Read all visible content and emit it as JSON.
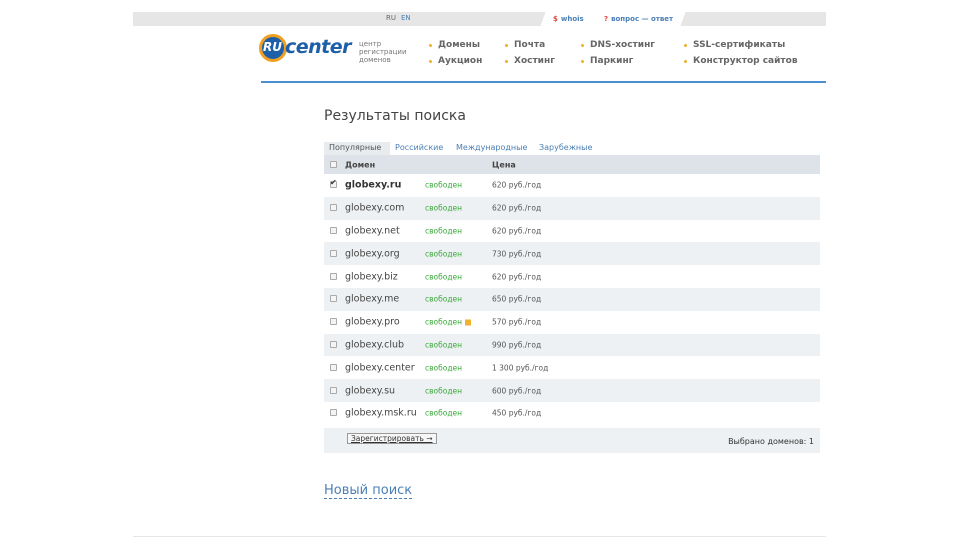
{
  "topbar": {
    "lang_ru": "RU",
    "lang_en": "EN",
    "whois_label": "whois",
    "whois_mark": "$",
    "qa_label": "вопрос — ответ",
    "qa_mark": "?"
  },
  "header": {
    "logo_ru": "RU",
    "logo_center": "center",
    "logo_sub": "центр регистрации доменов",
    "nav": [
      {
        "label": "Домены"
      },
      {
        "label": "Аукцион"
      },
      {
        "label": "Почта"
      },
      {
        "label": "Хостинг"
      },
      {
        "label": "DNS-хостинг"
      },
      {
        "label": "Паркинг"
      },
      {
        "label": "SSL-сертификаты"
      },
      {
        "label": "Конструктор сайтов"
      }
    ],
    "accent_color": "#4a8fd0"
  },
  "main": {
    "title": "Результаты поиска",
    "tabs": [
      {
        "label": "Популярные"
      },
      {
        "label": "Российские"
      },
      {
        "label": "Международные"
      },
      {
        "label": "Зарубежные"
      }
    ],
    "table": {
      "headers": {
        "domain": "Домен",
        "price": "Цена"
      },
      "rows": [
        {
          "domain": "globexy.ru",
          "status": "свободен",
          "price": "620 руб./год"
        },
        {
          "domain": "globexy.com",
          "status": "свободен",
          "price": "620 руб./год"
        },
        {
          "domain": "globexy.net",
          "status": "свободен",
          "price": "620 руб./год"
        },
        {
          "domain": "globexy.org",
          "status": "свободен",
          "price": "730 руб./год"
        },
        {
          "domain": "globexy.biz",
          "status": "свободен",
          "price": "620 руб./год"
        },
        {
          "domain": "globexy.me",
          "status": "свободен",
          "price": "650 руб./год"
        },
        {
          "domain": "globexy.pro",
          "status": "свободен",
          "price": "570 руб./год"
        },
        {
          "domain": "globexy.club",
          "status": "свободен",
          "price": "990 руб./год"
        },
        {
          "domain": "globexy.center",
          "status": "свободен",
          "price": "1 300 руб./год"
        },
        {
          "domain": "globexy.su",
          "status": "свободен",
          "price": "600 руб./год"
        },
        {
          "domain": "globexy.msk.ru",
          "status": "свободен",
          "price": "450 руб./год"
        }
      ]
    },
    "register_button": "Зарегистрировать →",
    "selected_count": "Выбрано доменов: 1",
    "new_search": "Новый поиск",
    "status_color": "#3aa83a"
  }
}
